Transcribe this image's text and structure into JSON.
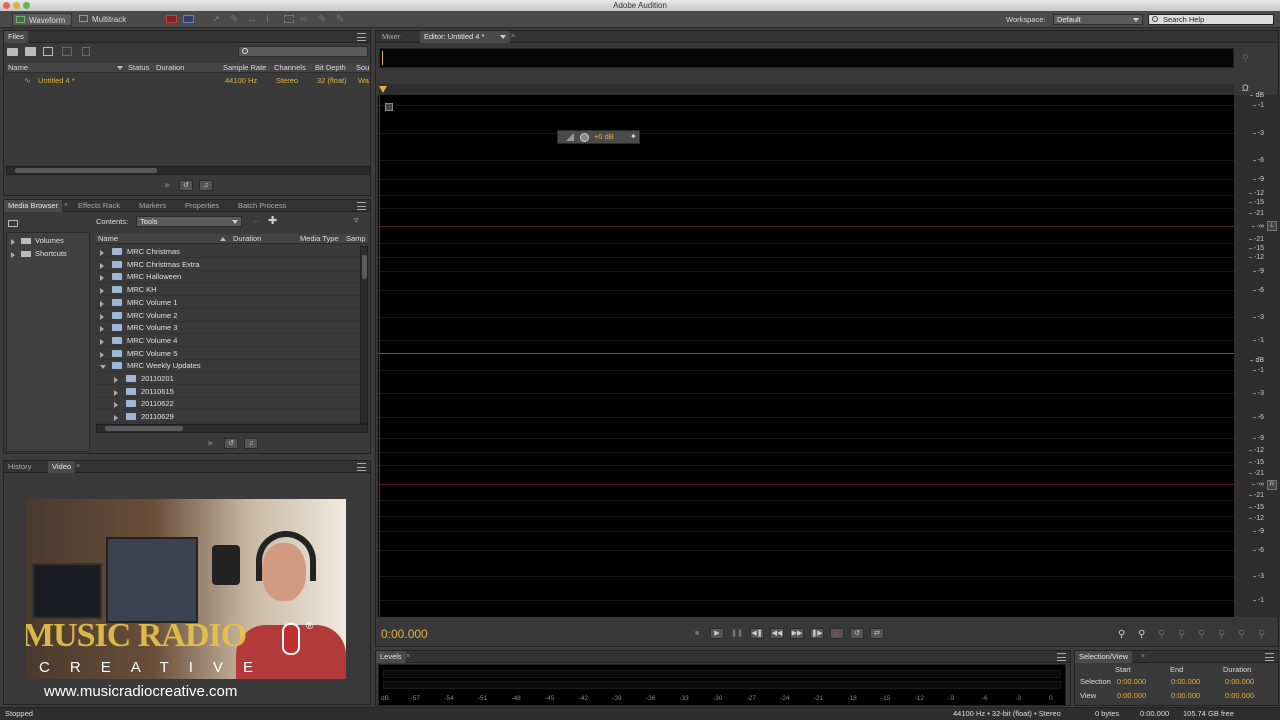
{
  "window": {
    "title": "Adobe Audition"
  },
  "toolbar": {
    "waveform": "Waveform",
    "multitrack": "Multitrack",
    "workspace_label": "Workspace:",
    "workspace_value": "Default",
    "search_placeholder": "Search Help"
  },
  "files_panel": {
    "tab": "Files",
    "columns": [
      "Name",
      "Status",
      "Duration",
      "Sample Rate",
      "Channels",
      "Bit Depth",
      "Sou"
    ],
    "file": {
      "name": "Untitled 4 *",
      "sample_rate": "44100 Hz",
      "channels": "Stereo",
      "bit_depth": "32 (float)",
      "source": "Wa"
    }
  },
  "media_panel": {
    "tabs": [
      "Media Browser",
      "Effects Rack",
      "Markers",
      "Properties",
      "Batch Process"
    ],
    "contents_label": "Contents:",
    "contents_value": "Tools",
    "tree": [
      "Volumes",
      "Shortcuts"
    ],
    "columns": [
      "Name",
      "Duration",
      "Media Type",
      "Samp"
    ],
    "folders": [
      {
        "name": "MRC Christmas",
        "indent": 0,
        "open": false
      },
      {
        "name": "MRC Christmas Extra",
        "indent": 0,
        "open": false
      },
      {
        "name": "MRC Halloween",
        "indent": 0,
        "open": false
      },
      {
        "name": "MRC KH",
        "indent": 0,
        "open": false
      },
      {
        "name": "MRC Volume 1",
        "indent": 0,
        "open": false
      },
      {
        "name": "MRC Volume 2",
        "indent": 0,
        "open": false
      },
      {
        "name": "MRC Volume 3",
        "indent": 0,
        "open": false
      },
      {
        "name": "MRC Volume 4",
        "indent": 0,
        "open": false
      },
      {
        "name": "MRC Volume 5",
        "indent": 0,
        "open": false
      },
      {
        "name": "MRC Weekly Updates",
        "indent": 0,
        "open": true
      },
      {
        "name": "20110201",
        "indent": 1,
        "open": false
      },
      {
        "name": "20110615",
        "indent": 1,
        "open": false
      },
      {
        "name": "20110622",
        "indent": 1,
        "open": false
      },
      {
        "name": "20110629",
        "indent": 1,
        "open": false
      }
    ]
  },
  "video_panel": {
    "tabs": [
      "History",
      "Video"
    ],
    "logo_text": "MUSIC RADIO",
    "logo_sub": "CREATIVE",
    "logo_mark": "®",
    "website": "www.musicradiocreative.com"
  },
  "editor": {
    "tabs": [
      "Mixer",
      "Editor: Untitled 4 *"
    ],
    "hud_gain": "+0 dB",
    "channel_left": "L",
    "channel_right": "R",
    "scale_top": [
      "dB",
      "-1",
      "-3",
      "-6",
      "-9",
      "-12",
      "-15",
      "-21",
      "-∞",
      "-21",
      "-15",
      "-12",
      "-9",
      "-6",
      "-3",
      "-1"
    ],
    "scale_bottom": [
      "dB",
      "-1",
      "-3",
      "-6",
      "-9",
      "-12",
      "-15",
      "-21",
      "-∞",
      "-21",
      "-15",
      "-12",
      "-9",
      "-6",
      "-3",
      "-1"
    ],
    "time": "0:00.000"
  },
  "levels_panel": {
    "tab": "Levels",
    "scale": [
      "dB",
      "-57",
      "-54",
      "-51",
      "-48",
      "-45",
      "-42",
      "-39",
      "-36",
      "-33",
      "-30",
      "-27",
      "-24",
      "-21",
      "-18",
      "-15",
      "-12",
      "-9",
      "-6",
      "-3",
      "0"
    ]
  },
  "selection_panel": {
    "tab": "Selection/View",
    "headers": [
      "Start",
      "End",
      "Duration"
    ],
    "rows": [
      {
        "label": "Selection",
        "start": "0:00.000",
        "end": "0:00.000",
        "duration": "0:00.000"
      },
      {
        "label": "View",
        "start": "0:00.000",
        "end": "0:00.000",
        "duration": "0:00.000"
      }
    ]
  },
  "status": {
    "left": "Stopped",
    "format": "44100 Hz • 32-bit (float) • Stereo",
    "size": "0 bytes",
    "duration": "0:00.000",
    "free": "105.74 GB free"
  },
  "colors": {
    "accent": "#e0b040",
    "waveform_bg": "#000000",
    "panel_bg": "#3a3a3a"
  }
}
